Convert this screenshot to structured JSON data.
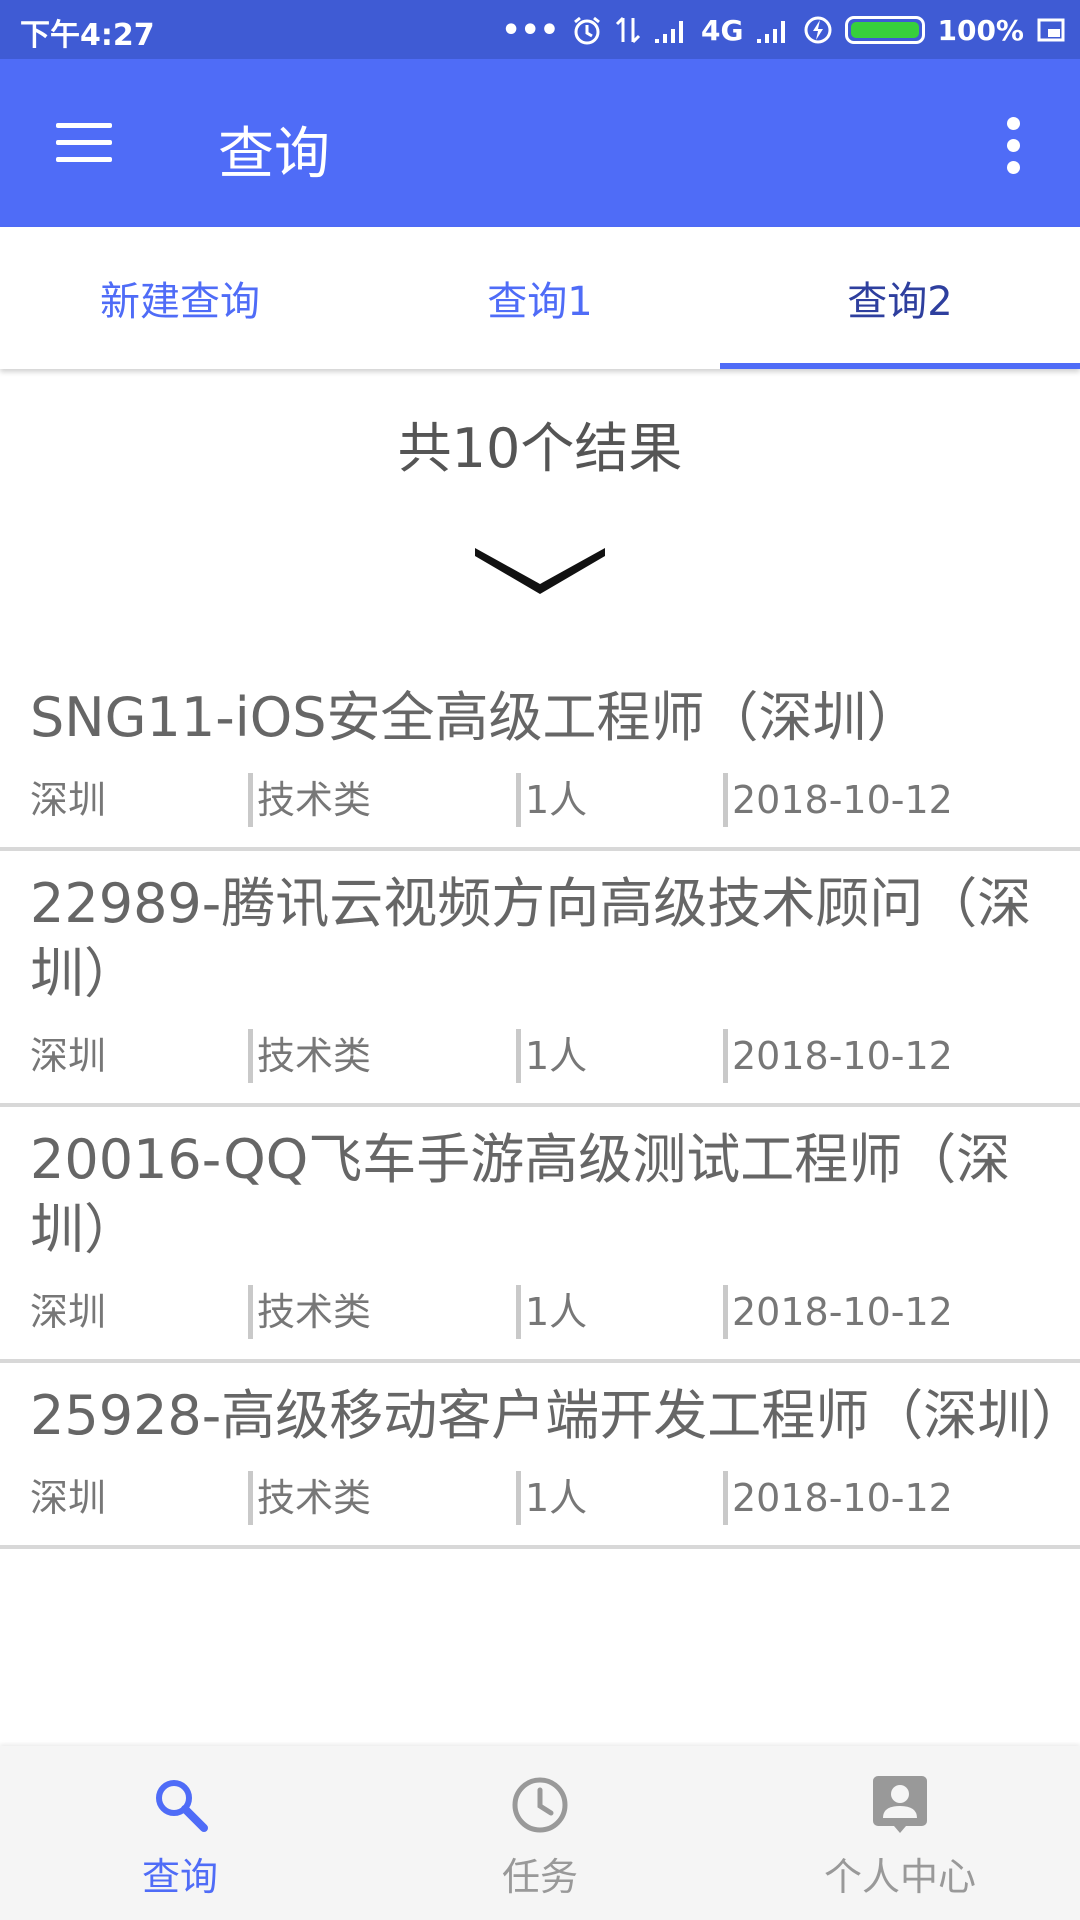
{
  "status_bar": {
    "time": "下午4:27",
    "network": "4G",
    "battery": "100%"
  },
  "app_bar": {
    "title": "查询"
  },
  "tabs": [
    {
      "label": "新建查询",
      "active": false
    },
    {
      "label": "查询1",
      "active": false
    },
    {
      "label": "查询2",
      "active": true
    }
  ],
  "results": {
    "count_text": "共10个结果"
  },
  "jobs": [
    {
      "title": "SNG11-iOS安全高级工程师（深圳）",
      "city": "深圳",
      "category": "技术类",
      "headcount": "1人",
      "date": "2018-10-12"
    },
    {
      "title": "22989-腾讯云视频方向高级技术顾问（深圳）",
      "city": "深圳",
      "category": "技术类",
      "headcount": "1人",
      "date": "2018-10-12"
    },
    {
      "title": "20016-QQ飞车手游高级测试工程师（深圳）",
      "city": "深圳",
      "category": "技术类",
      "headcount": "1人",
      "date": "2018-10-12"
    },
    {
      "title": "25928-高级移动客户端开发工程师（深圳）",
      "city": "深圳",
      "category": "技术类",
      "headcount": "1人",
      "date": "2018-10-12"
    }
  ],
  "bottom_nav": [
    {
      "label": "查询",
      "icon": "search-icon",
      "active": true
    },
    {
      "label": "任务",
      "icon": "clock-icon",
      "active": false
    },
    {
      "label": "个人中心",
      "icon": "person-icon",
      "active": false
    }
  ],
  "colors": {
    "status_bar": "#3f5bd4",
    "app_bar": "#4f6cf7",
    "tab_active": "#2e3f9e",
    "battery": "#37d03c"
  }
}
